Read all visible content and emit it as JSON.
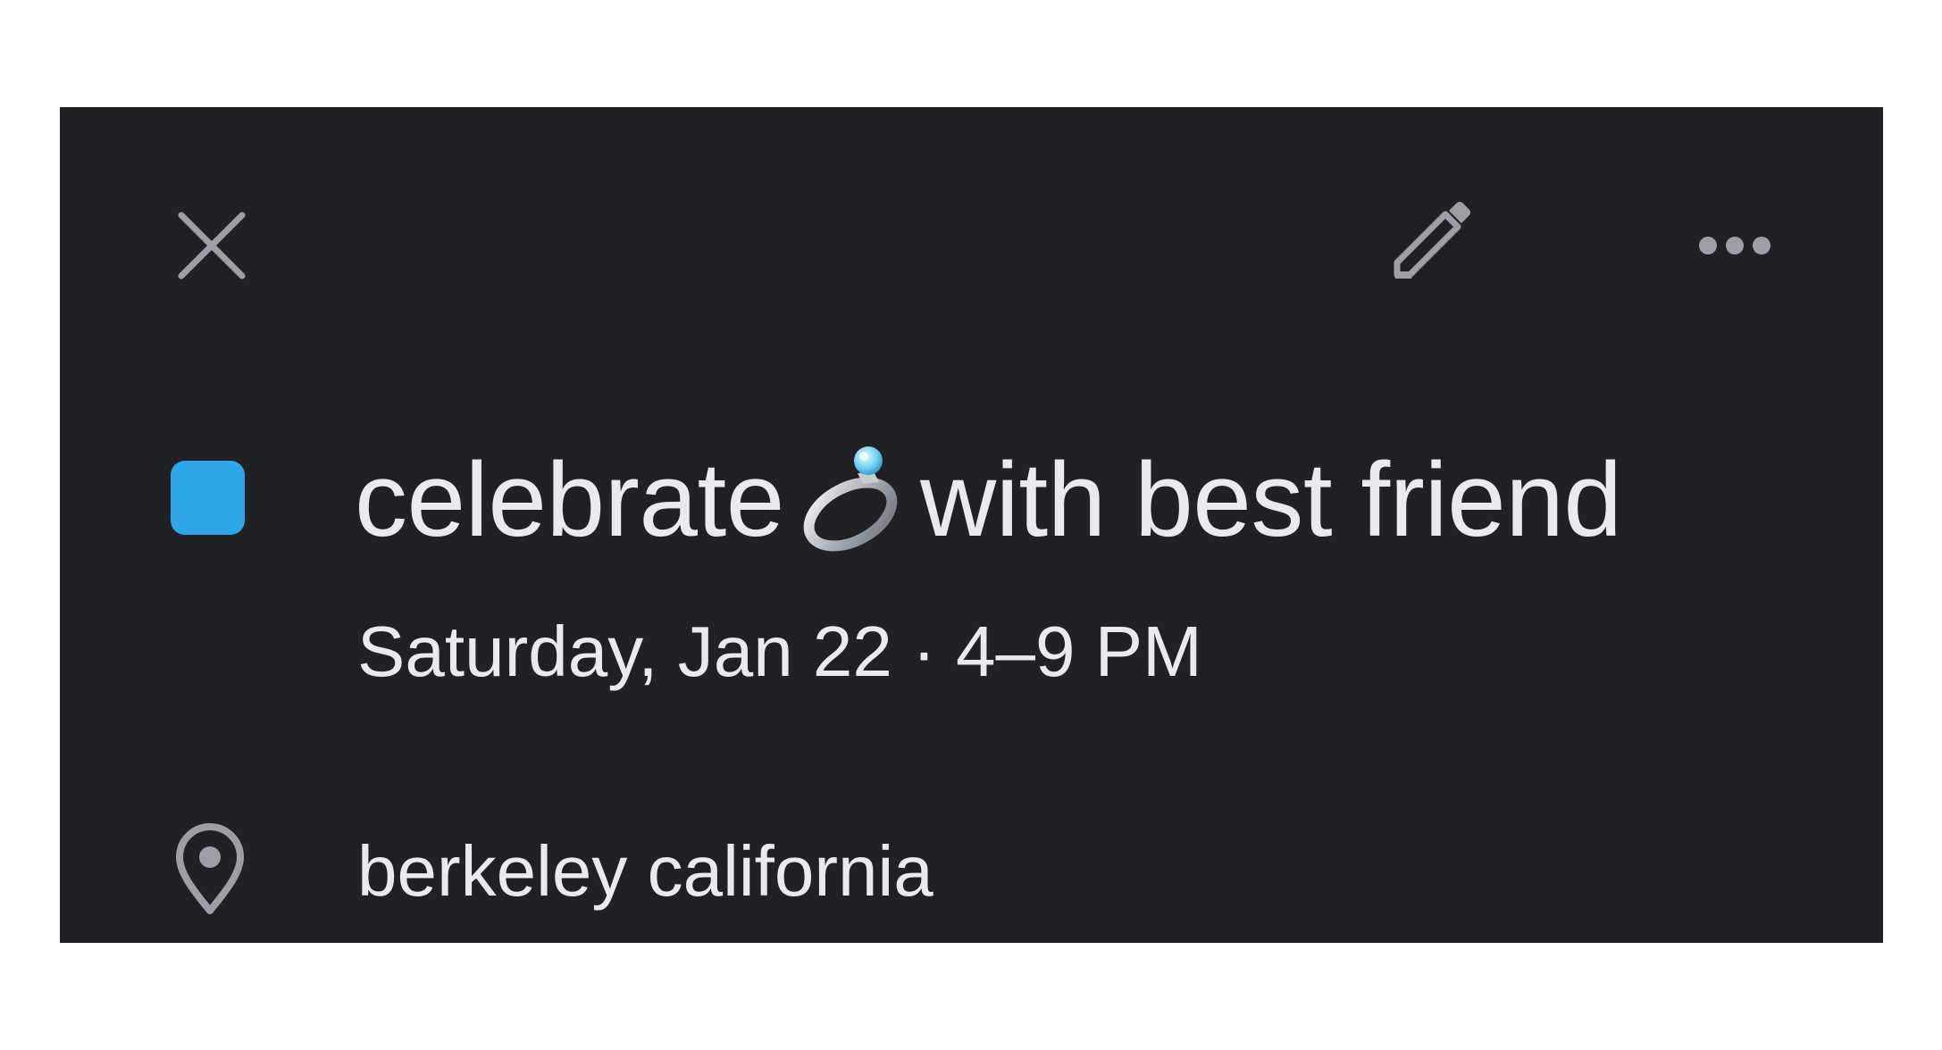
{
  "event": {
    "title_before": "celebrate",
    "title_emoji": "ring-icon",
    "title_after": "with best friend",
    "datetime": "Saturday, Jan 22 · 4–9 PM",
    "location": "berkeley california",
    "calendar_color": "#2ea6e8"
  },
  "toolbar": {
    "close_icon": "close-icon",
    "edit_icon": "pencil-icon",
    "more_icon": "more-horizontal-icon"
  },
  "colors": {
    "background": "#202124",
    "text": "#e8eaed",
    "icon": "#9aa0a6"
  }
}
